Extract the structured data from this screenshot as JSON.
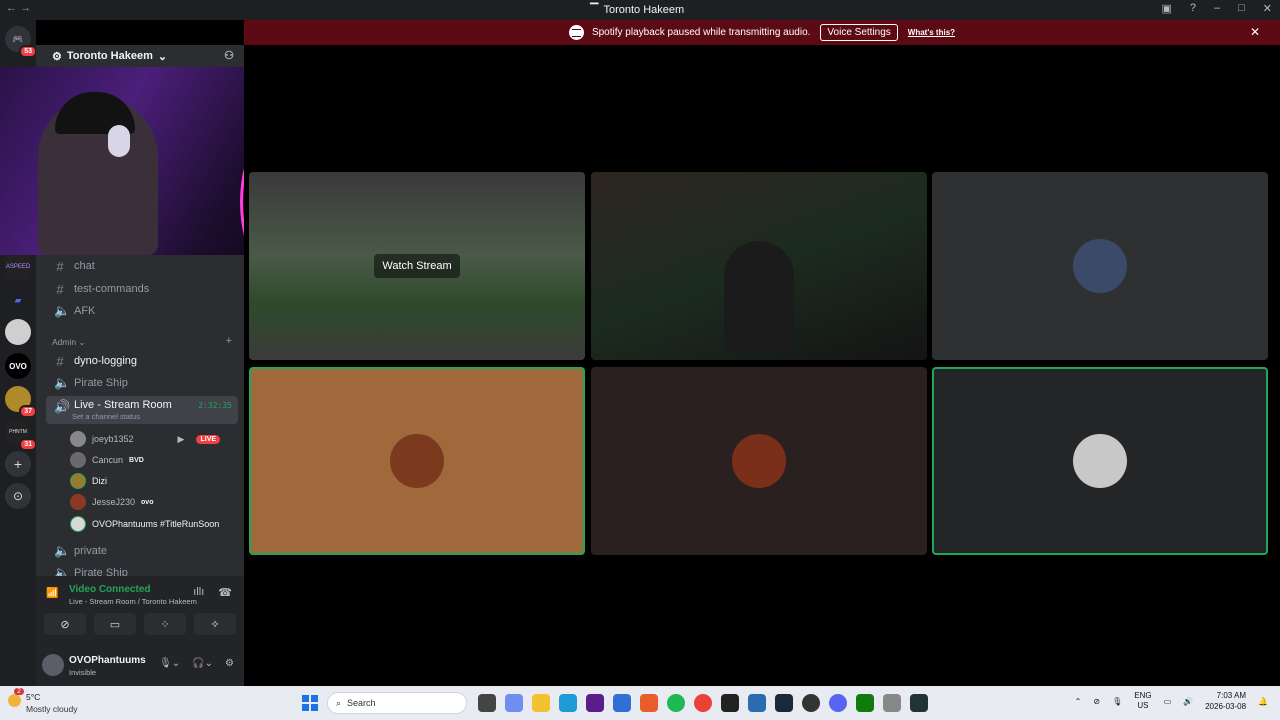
{
  "window": {
    "title": "Toronto Hakeem"
  },
  "banner": {
    "message": "Spotify playback paused while transmitting audio.",
    "button_label": "Voice Settings",
    "link_label": "What's this?"
  },
  "guilds": [
    {
      "name": "home-discord",
      "badge": "53"
    },
    {
      "name": "server-aspeed",
      "badge": ""
    },
    {
      "name": "server-folder",
      "badge": ""
    },
    {
      "name": "server-avatar",
      "badge": ""
    },
    {
      "name": "server-ovo",
      "badge": ""
    },
    {
      "name": "server-wave",
      "badge": "37"
    },
    {
      "name": "server-phantom",
      "badge": "31"
    }
  ],
  "sidebar": {
    "server_name": "Toronto Hakeem",
    "channels_top": [
      {
        "name": "chat",
        "type": "text"
      },
      {
        "name": "test-commands",
        "type": "text"
      },
      {
        "name": "AFK",
        "type": "voice"
      }
    ],
    "category": "Admin",
    "channels_admin": [
      {
        "name": "dyno-logging",
        "type": "text"
      },
      {
        "name": "Pirate Ship",
        "type": "voice"
      }
    ],
    "active_voice": {
      "name": "Live - Stream Room",
      "timer": "2:32:35",
      "status": "Set a channel status"
    },
    "voice_users": [
      {
        "name": "joeyb1352",
        "live": "LIVE",
        "tag": ""
      },
      {
        "name": "Cancun",
        "live": "",
        "tag": "BVD"
      },
      {
        "name": "Dizi",
        "live": "",
        "tag": ""
      },
      {
        "name": "JesseJ230",
        "live": "",
        "tag": "ovo"
      },
      {
        "name": "OVOPhantuums #TitleRunSoon",
        "live": "",
        "tag": ""
      }
    ],
    "channels_bottom": [
      {
        "name": "private",
        "type": "voice"
      },
      {
        "name": "Pirate Ship",
        "type": "voice"
      }
    ]
  },
  "voice_panel": {
    "title": "Video Connected",
    "subtitle": "Live - Stream Room / Toronto Hakeem"
  },
  "user_panel": {
    "name": "OVOPhantuums",
    "status": "Invisible"
  },
  "stage": {
    "watch_label": "Watch Stream"
  },
  "taskbar": {
    "temp": "5°C",
    "weather": "Mostly cloudy",
    "weather_badge": "2",
    "search_placeholder": "Search",
    "lang_top": "ENG",
    "lang_bottom": "US",
    "time": "7:03 AM",
    "date": "2026-03-08"
  },
  "colors": {
    "discord_bg": "#313338",
    "sidebar_bg": "#2b2d31",
    "banner_bg": "#5c0a14",
    "green_connected": "#23a55a",
    "live_red": "#f23f43"
  }
}
